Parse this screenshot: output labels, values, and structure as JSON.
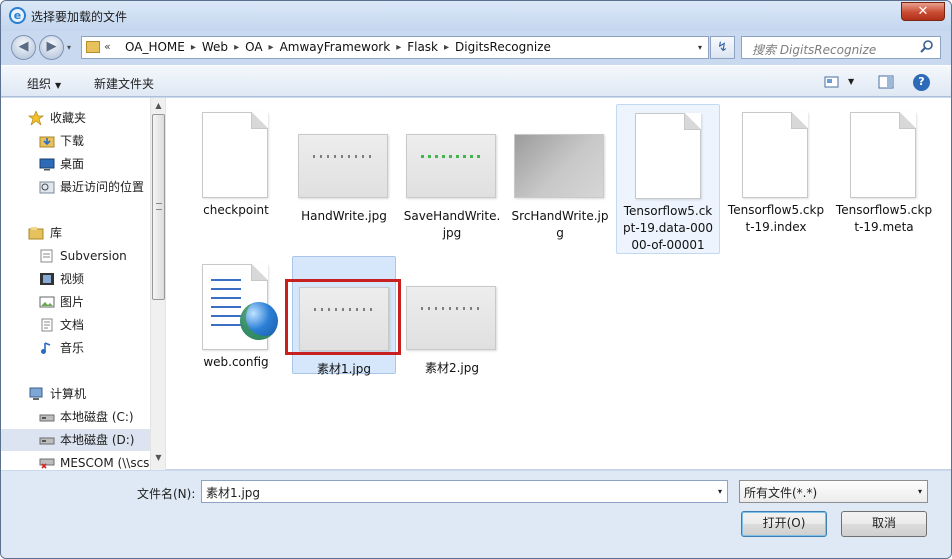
{
  "window": {
    "title": "选择要加载的文件",
    "close_glyph": "✕",
    "title_icon_glyph": "e"
  },
  "nav": {
    "back_glyph": "◀",
    "forward_glyph": "▶",
    "dropdown_glyph": "▾",
    "refresh_glyph": "↯"
  },
  "address": {
    "chevron": "«",
    "crumbs": [
      "OA_HOME",
      "Web",
      "OA",
      "AmwayFramework",
      "Flask",
      "DigitsRecognize"
    ],
    "separator": "▸"
  },
  "search": {
    "placeholder": "搜索 DigitsRecognize"
  },
  "toolbar": {
    "organize_label": "组织",
    "new_folder_label": "新建文件夹",
    "caret": "▼",
    "view_icon": "view-icon",
    "preview_pane_icon": "preview-pane-icon",
    "help_glyph": "?"
  },
  "sidebar": {
    "favorites": {
      "label": "收藏夹",
      "items": [
        {
          "label": "下载",
          "icon": "downloads-icon"
        },
        {
          "label": "桌面",
          "icon": "desktop-icon"
        },
        {
          "label": "最近访问的位置",
          "icon": "recent-places-icon"
        }
      ]
    },
    "libraries": {
      "label": "库",
      "items": [
        {
          "label": "Subversion",
          "icon": "subversion-icon"
        },
        {
          "label": "视频",
          "icon": "video-icon"
        },
        {
          "label": "图片",
          "icon": "pictures-icon"
        },
        {
          "label": "文档",
          "icon": "documents-icon"
        },
        {
          "label": "音乐",
          "icon": "music-icon"
        }
      ]
    },
    "computer": {
      "label": "计算机",
      "items": [
        {
          "label": "本地磁盘 (C:)",
          "icon": "drive-icon"
        },
        {
          "label": "本地磁盘 (D:)",
          "icon": "drive-icon",
          "selected": true
        },
        {
          "label": "MESCOM (\\\\scs",
          "icon": "network-drive-icon"
        }
      ]
    },
    "scroll_up": "▲",
    "scroll_down": "▼"
  },
  "files": [
    {
      "name": "checkpoint",
      "kind": "document"
    },
    {
      "name": "HandWrite.jpg",
      "kind": "image",
      "dots": "gray"
    },
    {
      "name": "SaveHandWrite.jpg",
      "kind": "image",
      "dots": "green"
    },
    {
      "name": "SrcHandWrite.jpg",
      "kind": "image",
      "dots": "none",
      "dark": true
    },
    {
      "name": "Tensorflow5.ckpt-19.data-00000-of-00001",
      "kind": "document",
      "hover": true
    },
    {
      "name": "Tensorflow5.ckpt-19.index",
      "kind": "document"
    },
    {
      "name": "Tensorflow5.ckpt-19.meta",
      "kind": "document"
    },
    {
      "name": "web.config",
      "kind": "config"
    },
    {
      "name": "素材1.jpg",
      "kind": "image",
      "dots": "gray",
      "selected": true,
      "highlight": true
    },
    {
      "name": "素材2.jpg",
      "kind": "image",
      "dots": "gray"
    }
  ],
  "footer": {
    "filename_label": "文件名(N):",
    "filename_value": "素材1.jpg",
    "filetype_value": "所有文件(*.*)",
    "open_label": "打开(O)",
    "cancel_label": "取消",
    "dropdown_glyph": "▾"
  },
  "colors": {
    "highlight_box": "#c82020",
    "selection": "#d7e7fb",
    "window_frame": "#c9daf0"
  }
}
